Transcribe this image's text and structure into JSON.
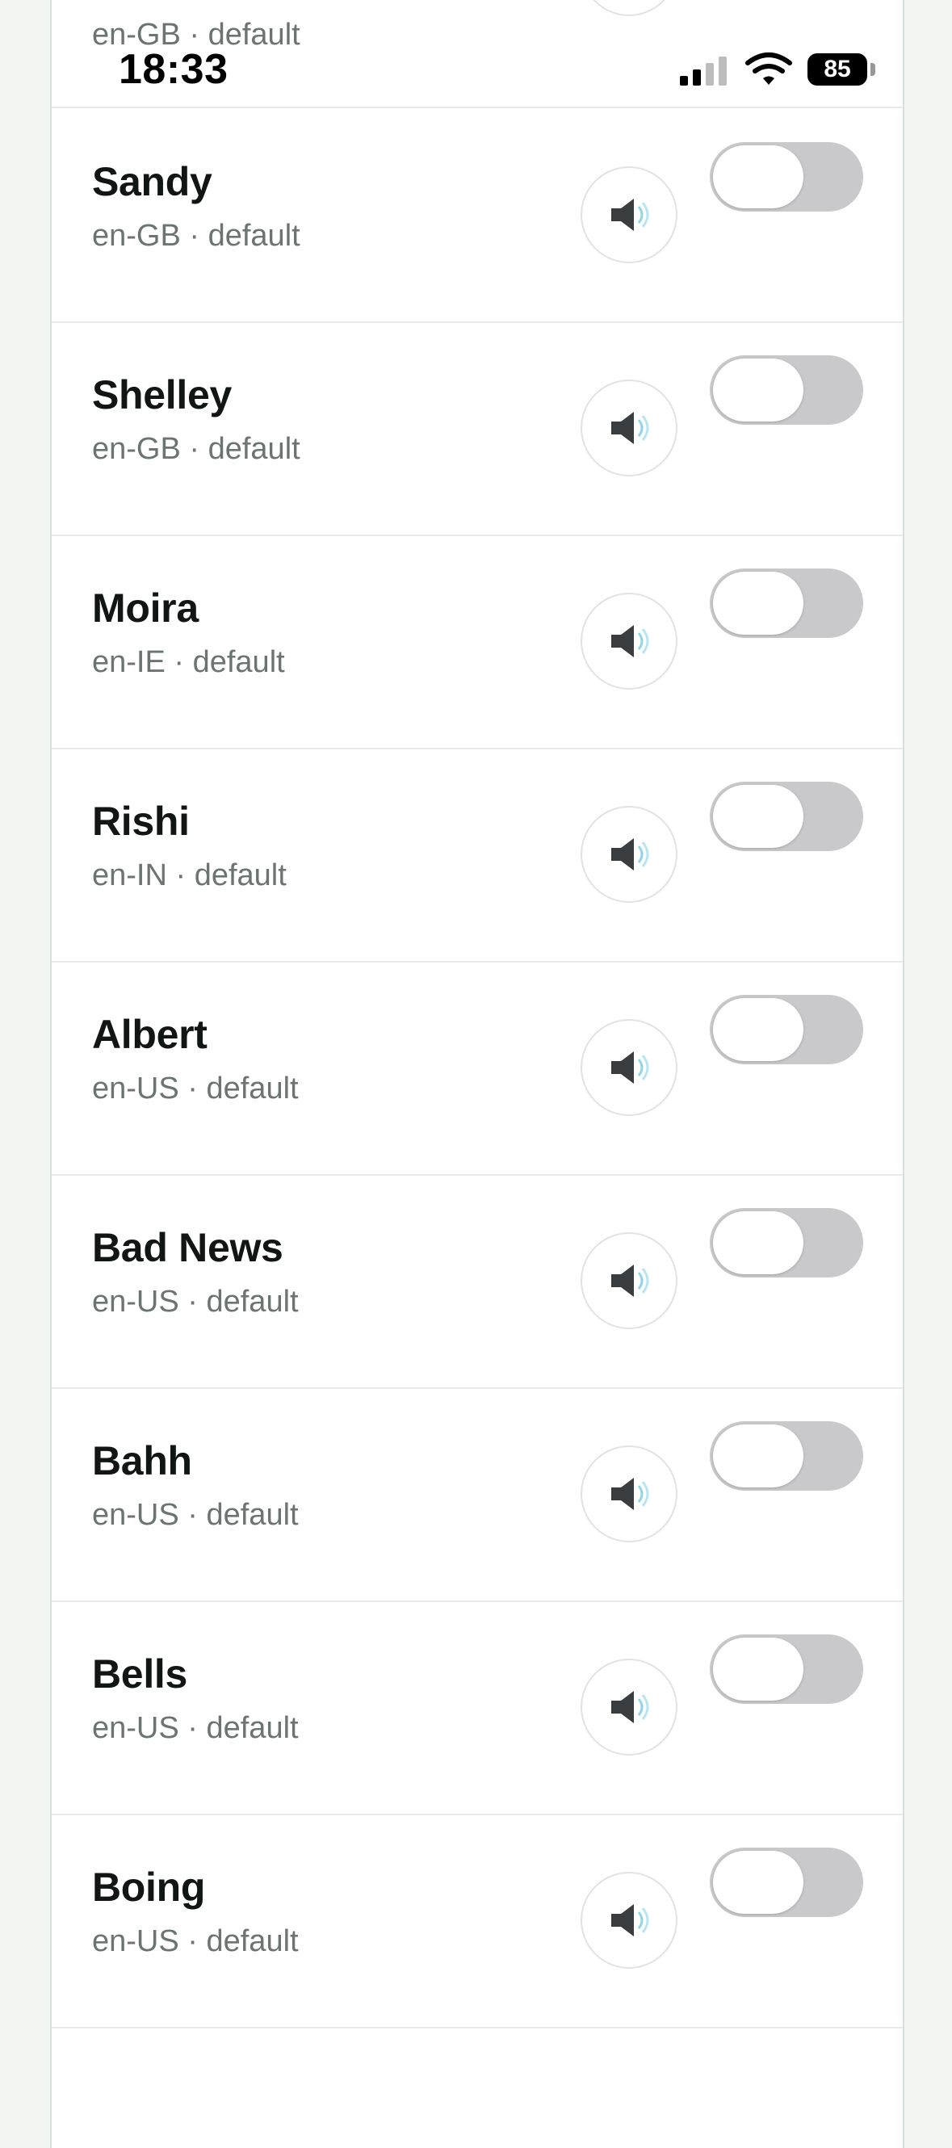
{
  "status_bar": {
    "time": "18:33",
    "battery": "85"
  },
  "partial_row": {
    "meta": "en-GB · default"
  },
  "voices": [
    {
      "name": "Sandy",
      "meta": "en-GB · default"
    },
    {
      "name": "Shelley",
      "meta": "en-GB · default"
    },
    {
      "name": "Moira",
      "meta": "en-IE · default"
    },
    {
      "name": "Rishi",
      "meta": "en-IN · default"
    },
    {
      "name": "Albert",
      "meta": "en-US · default"
    },
    {
      "name": "Bad News",
      "meta": "en-US · default"
    },
    {
      "name": "Bahh",
      "meta": "en-US · default"
    },
    {
      "name": "Bells",
      "meta": "en-US · default"
    },
    {
      "name": "Boing",
      "meta": "en-US · default"
    }
  ],
  "icons": {
    "play": "speaker-icon"
  },
  "colors": {
    "toggle_off": "#c9c9cb",
    "name_text": "#111614",
    "meta_text": "#6b7470"
  }
}
